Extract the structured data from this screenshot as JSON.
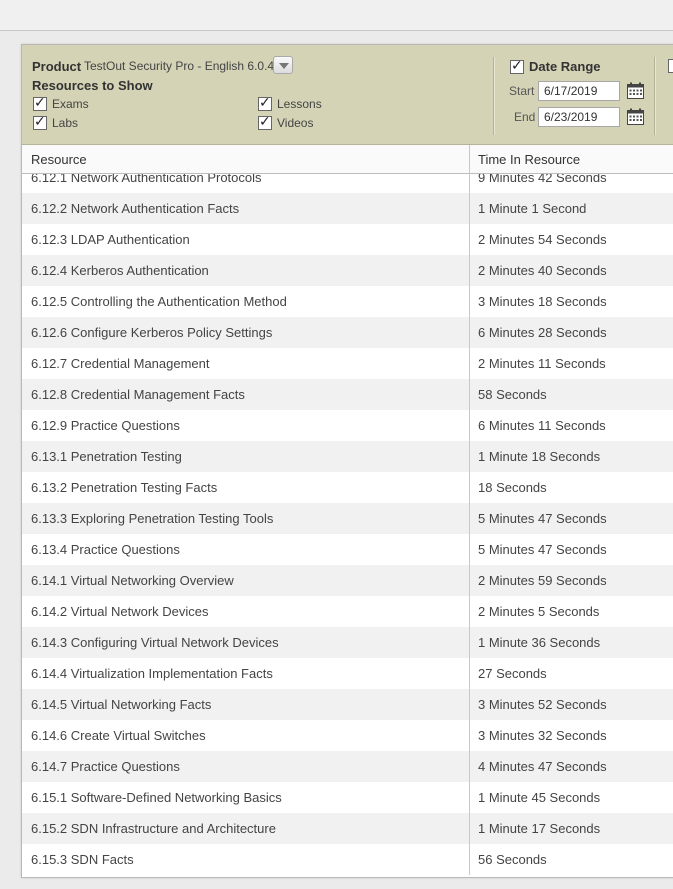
{
  "filters": {
    "product_label": "Product",
    "product_value": "TestOut Security Pro - English 6.0.4",
    "resources_label": "Resources to Show",
    "resources": [
      {
        "label": "Exams",
        "checked": true
      },
      {
        "label": "Lessons",
        "checked": true
      },
      {
        "label": "Labs",
        "checked": true
      },
      {
        "label": "Videos",
        "checked": true
      }
    ],
    "date_range": {
      "label": "Date Range",
      "checked": true,
      "start_label": "Start",
      "start_value": "6/17/2019",
      "end_label": "End",
      "end_value": "6/23/2019"
    }
  },
  "table": {
    "columns": [
      "Resource",
      "Time In Resource"
    ],
    "rows": [
      {
        "resource": "6.12.1 Network Authentication Protocols",
        "time": "9 Minutes 42 Seconds"
      },
      {
        "resource": "6.12.2 Network Authentication Facts",
        "time": "1 Minute 1 Second"
      },
      {
        "resource": "6.12.3 LDAP Authentication",
        "time": "2 Minutes 54 Seconds"
      },
      {
        "resource": "6.12.4 Kerberos Authentication",
        "time": "2 Minutes 40 Seconds"
      },
      {
        "resource": "6.12.5 Controlling the Authentication Method",
        "time": "3 Minutes 18 Seconds"
      },
      {
        "resource": "6.12.6 Configure Kerberos Policy Settings",
        "time": "6 Minutes 28 Seconds"
      },
      {
        "resource": "6.12.7 Credential Management",
        "time": "2 Minutes 11 Seconds"
      },
      {
        "resource": "6.12.8 Credential Management Facts",
        "time": "58 Seconds"
      },
      {
        "resource": "6.12.9 Practice Questions",
        "time": "6 Minutes 11 Seconds"
      },
      {
        "resource": "6.13.1 Penetration Testing",
        "time": "1 Minute 18 Seconds"
      },
      {
        "resource": "6.13.2 Penetration Testing Facts",
        "time": "18 Seconds"
      },
      {
        "resource": "6.13.3 Exploring Penetration Testing Tools",
        "time": "5 Minutes 47 Seconds"
      },
      {
        "resource": "6.13.4 Practice Questions",
        "time": "5 Minutes 47 Seconds"
      },
      {
        "resource": "6.14.1 Virtual Networking Overview",
        "time": "2 Minutes 59 Seconds"
      },
      {
        "resource": "6.14.2 Virtual Network Devices",
        "time": "2 Minutes 5 Seconds"
      },
      {
        "resource": "6.14.3 Configuring Virtual Network Devices",
        "time": "1 Minute 36 Seconds"
      },
      {
        "resource": "6.14.4 Virtualization Implementation Facts",
        "time": "27 Seconds"
      },
      {
        "resource": "6.14.5 Virtual Networking Facts",
        "time": "3 Minutes 52 Seconds"
      },
      {
        "resource": "6.14.6 Create Virtual Switches",
        "time": "3 Minutes 32 Seconds"
      },
      {
        "resource": "6.14.7 Practice Questions",
        "time": "4 Minutes 47 Seconds"
      },
      {
        "resource": "6.15.1 Software-Defined Networking Basics",
        "time": "1 Minute 45 Seconds"
      },
      {
        "resource": "6.15.2 SDN Infrastructure and Architecture",
        "time": "1 Minute 17 Seconds"
      },
      {
        "resource": "6.15.3 SDN Facts",
        "time": "56 Seconds"
      }
    ]
  },
  "icons": {
    "dropdown": "chevron-down-icon",
    "calendar": "calendar-icon",
    "checkbox": "check-icon"
  }
}
